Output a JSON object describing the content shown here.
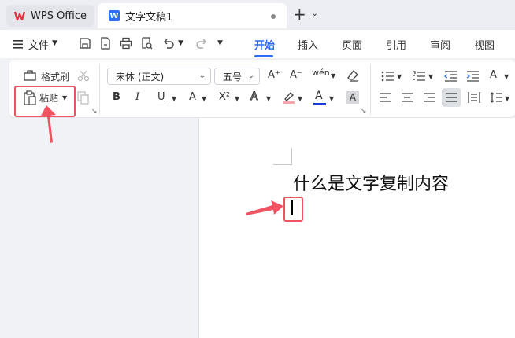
{
  "tabs": {
    "home_label": "WPS Office",
    "doc_label": "文字文稿1",
    "doc_icon_letter": "W",
    "new_tab": "+",
    "chevron": "⌄"
  },
  "menubar": {
    "file_label": "文件",
    "tabs": [
      "开始",
      "插入",
      "页面",
      "引用",
      "审阅",
      "视图"
    ],
    "active_tab": "开始"
  },
  "ribbon": {
    "format_painter_label": "格式刷",
    "paste_label": "粘贴",
    "font_name": "宋体 (正文)",
    "font_size": "五号",
    "font_grow": "A⁺",
    "font_shrink": "A⁻",
    "pinyin": "wén",
    "bold": "B",
    "italic": "I",
    "underline": "U",
    "strike": "A",
    "superscript": "X²",
    "font_color_letter": "A",
    "char_shade": "A",
    "font_color_hex": "#1b3fd6"
  },
  "document": {
    "text": "什么是文字复制内容"
  },
  "colors": {
    "accent": "#2f6cf5",
    "highlight": "#f05462",
    "brand": "#e6313c"
  }
}
